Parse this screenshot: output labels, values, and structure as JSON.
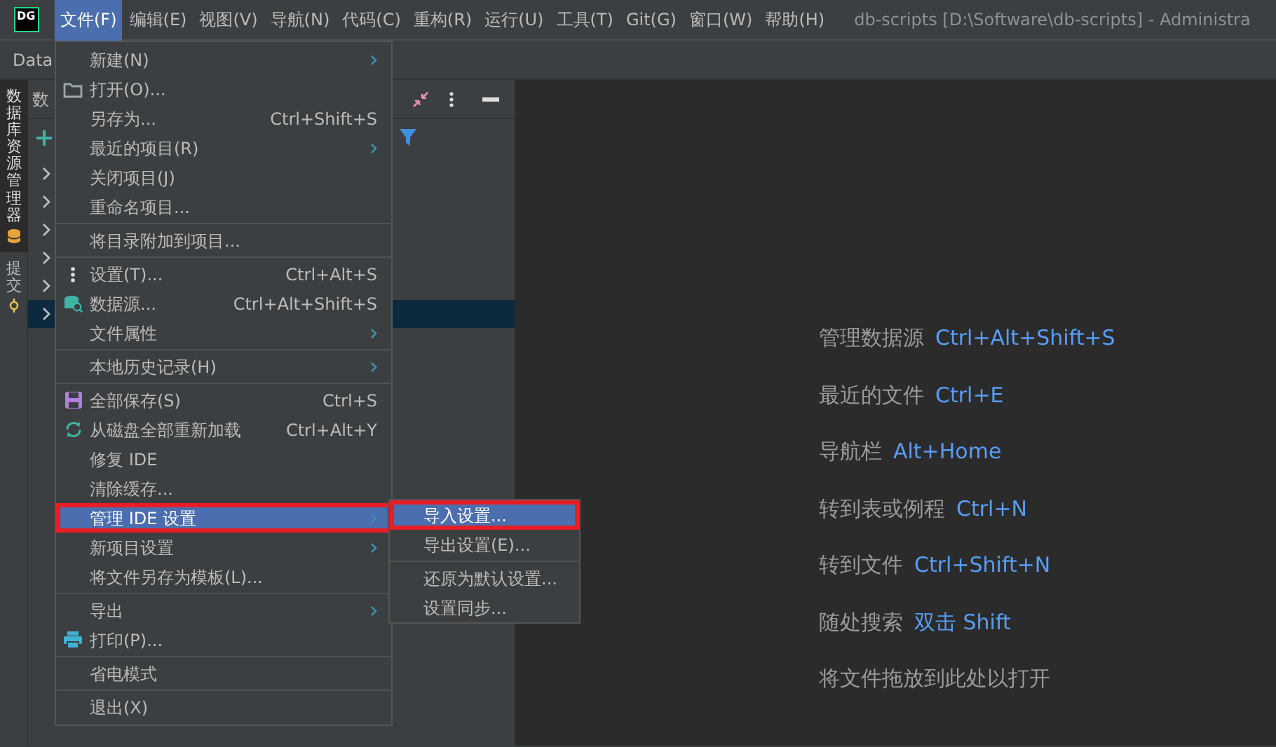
{
  "app": {
    "logo": "DG"
  },
  "menubar": [
    {
      "label": "文件(F)",
      "selected": true
    },
    {
      "label": "编辑(E)",
      "selected": false
    },
    {
      "label": "视图(V)",
      "selected": false
    },
    {
      "label": "导航(N)",
      "selected": false
    },
    {
      "label": "代码(C)",
      "selected": false
    },
    {
      "label": "重构(R)",
      "selected": false
    },
    {
      "label": "运行(U)",
      "selected": false
    },
    {
      "label": "工具(T)",
      "selected": false
    },
    {
      "label": "Git(G)",
      "selected": false
    },
    {
      "label": "窗口(W)",
      "selected": false
    },
    {
      "label": "帮助(H)",
      "selected": false
    }
  ],
  "window": {
    "title": "db-scripts [D:\\Software\\db-scripts] - Administra"
  },
  "toolbar": {
    "label": "Data"
  },
  "tool_tabs": [
    {
      "label": "数据库资源管理器",
      "selected": true
    },
    {
      "label": "提交",
      "selected": false
    }
  ],
  "panel": {
    "title": "数",
    "tree_rows": [
      {
        "selected": false
      },
      {
        "selected": false
      },
      {
        "selected": false
      },
      {
        "selected": false
      },
      {
        "selected": false
      },
      {
        "selected": true
      }
    ]
  },
  "file_menu": {
    "items": [
      {
        "kind": "item",
        "label": "新建(N)",
        "submenu": true
      },
      {
        "kind": "item",
        "label": "打开(O)..."
      },
      {
        "kind": "item",
        "label": "另存为...",
        "shortcut": "Ctrl+Shift+S"
      },
      {
        "kind": "item",
        "label": "最近的项目(R)",
        "submenu": true
      },
      {
        "kind": "item",
        "label": "关闭项目(J)"
      },
      {
        "kind": "item",
        "label": "重命名项目..."
      },
      {
        "kind": "separator"
      },
      {
        "kind": "item",
        "label": "将目录附加到项目..."
      },
      {
        "kind": "separator"
      },
      {
        "kind": "item",
        "label": "设置(T)...",
        "shortcut": "Ctrl+Alt+S"
      },
      {
        "kind": "item",
        "label": "数据源...",
        "shortcut": "Ctrl+Alt+Shift+S"
      },
      {
        "kind": "item",
        "label": "文件属性",
        "submenu": true
      },
      {
        "kind": "separator"
      },
      {
        "kind": "item",
        "label": "本地历史记录(H)",
        "submenu": true
      },
      {
        "kind": "separator"
      },
      {
        "kind": "item",
        "label": "全部保存(S)",
        "shortcut": "Ctrl+S"
      },
      {
        "kind": "item",
        "label": "从磁盘全部重新加载",
        "shortcut": "Ctrl+Alt+Y"
      },
      {
        "kind": "item",
        "label": "修复 IDE"
      },
      {
        "kind": "item",
        "label": "清除缓存..."
      },
      {
        "kind": "item",
        "label": "管理 IDE 设置",
        "submenu": true,
        "selected": true,
        "highlighted": true
      },
      {
        "kind": "item",
        "label": "新项目设置",
        "submenu": true
      },
      {
        "kind": "item",
        "label": "将文件另存为模板(L)..."
      },
      {
        "kind": "separator"
      },
      {
        "kind": "item",
        "label": "导出",
        "submenu": true
      },
      {
        "kind": "item",
        "label": "打印(P)..."
      },
      {
        "kind": "separator"
      },
      {
        "kind": "item",
        "label": "省电模式"
      },
      {
        "kind": "separator"
      },
      {
        "kind": "item",
        "label": "退出(X)"
      }
    ]
  },
  "submenu": {
    "items": [
      {
        "kind": "item",
        "label": "导入设置...",
        "selected": true,
        "highlighted": true
      },
      {
        "kind": "item",
        "label": "导出设置(E)...",
        "selected": false,
        "highlighted": false
      },
      {
        "kind": "separator"
      },
      {
        "kind": "item",
        "label": "还原为默认设置...",
        "selected": false,
        "highlighted": false
      },
      {
        "kind": "item",
        "label": "设置同步...",
        "selected": false,
        "highlighted": false
      }
    ]
  },
  "editor_hints": [
    {
      "label": "管理数据源",
      "shortcut": "Ctrl+Alt+Shift+S"
    },
    {
      "label": "最近的文件",
      "shortcut": "Ctrl+E"
    },
    {
      "label": "导航栏",
      "shortcut": "Alt+Home"
    },
    {
      "label": "转到表或例程",
      "shortcut": "Ctrl+N"
    },
    {
      "label": "转到文件",
      "shortcut": "Ctrl+Shift+N"
    },
    {
      "label": "随处搜索",
      "shortcut": "双击 Shift"
    },
    {
      "label": "将文件拖放到此处以打开"
    }
  ]
}
